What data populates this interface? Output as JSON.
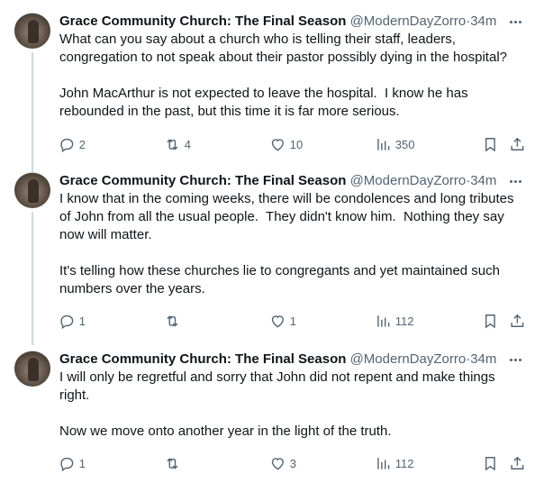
{
  "tweets": [
    {
      "name": "Grace Community Church: The Final Season",
      "handle": "@ModernDayZorro",
      "separator": "·",
      "time": "34m",
      "paragraphs": [
        "What can you say about a church who is telling their staff, leaders, congregation to not speak about their pastor possibly dying in the hospital?",
        "John MacArthur is not expected to leave the hospital.  I know he has rebounded in the past, but this time it is far more serious."
      ],
      "replies": "2",
      "reposts": "4",
      "likes": "10",
      "views": "350"
    },
    {
      "name": "Grace Community Church: The Final Season",
      "handle": "@ModernDayZorro",
      "separator": "·",
      "time": "34m",
      "paragraphs": [
        "I know that in the coming weeks, there will be condolences and long tributes of John from all the usual people.  They didn't know him.  Nothing they say now will matter.",
        "It's telling how these churches lie to congregants and yet maintained such numbers over the years."
      ],
      "replies": "1",
      "reposts": "",
      "likes": "1",
      "views": "112"
    },
    {
      "name": "Grace Community Church: The Final Season",
      "handle": "@ModernDayZorro",
      "separator": "·",
      "time": "34m",
      "paragraphs": [
        "I will only be regretful and sorry that John did not repent and make things right.",
        "Now we move onto another year in the light of the truth."
      ],
      "replies": "1",
      "reposts": "",
      "likes": "3",
      "views": "112"
    }
  ],
  "icons": {
    "reply": "speech-bubble-icon",
    "repost": "repost-arrows-icon",
    "like": "heart-icon",
    "views": "bar-chart-icon",
    "bookmark": "bookmark-icon",
    "share": "share-upload-icon",
    "more": "more-dots-icon"
  },
  "colors": {
    "text": "#0f1419",
    "secondary": "#536471",
    "thread_line": "#cfd9de"
  }
}
